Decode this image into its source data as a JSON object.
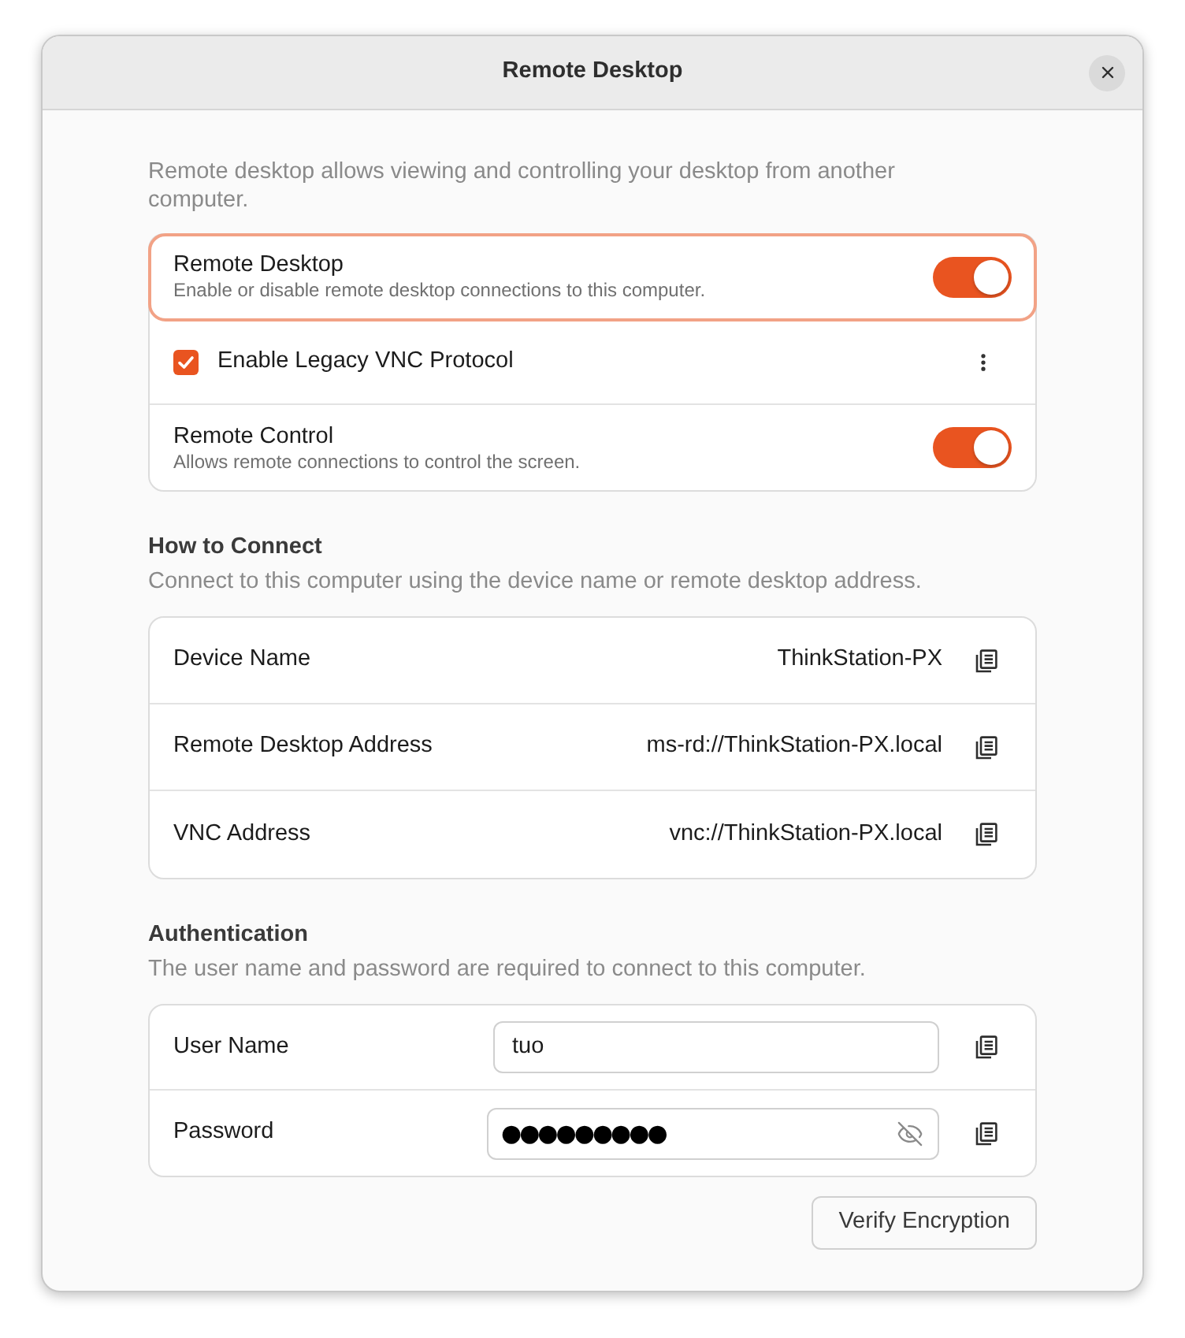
{
  "window": {
    "title": "Remote Desktop"
  },
  "intro": "Remote desktop allows viewing and controlling your desktop from another computer.",
  "sharing": [
    {
      "kind": "switch",
      "title": "Remote Desktop",
      "subtitle": "Enable or disable remote desktop connections to this computer.",
      "on": true,
      "focused": true
    },
    {
      "kind": "checkbox",
      "title": "Enable Legacy VNC Protocol",
      "checked": true,
      "focused": false
    },
    {
      "kind": "switch",
      "title": "Remote Control",
      "subtitle": "Allows remote connections to control the screen.",
      "on": true,
      "focused": false
    }
  ],
  "how_to_connect": {
    "heading": "How to Connect",
    "description": "Connect to this computer using the device name or remote desktop address.",
    "rows": [
      {
        "label": "Device Name",
        "value": "ThinkStation-PX"
      },
      {
        "label": "Remote Desktop Address",
        "value": "ms-rd://ThinkStation-PX.local"
      },
      {
        "label": "VNC Address",
        "value": "vnc://ThinkStation-PX.local"
      }
    ]
  },
  "authentication": {
    "heading": "Authentication",
    "description": "The user name and password are required to connect to this computer.",
    "fields": [
      {
        "kind": "text",
        "label": "User Name",
        "value": "tuo"
      },
      {
        "kind": "password",
        "label": "Password",
        "value": "●●●●●●●●●",
        "revealed": false
      }
    ]
  },
  "buttons": [
    {
      "label": "Verify Encryption"
    }
  ]
}
